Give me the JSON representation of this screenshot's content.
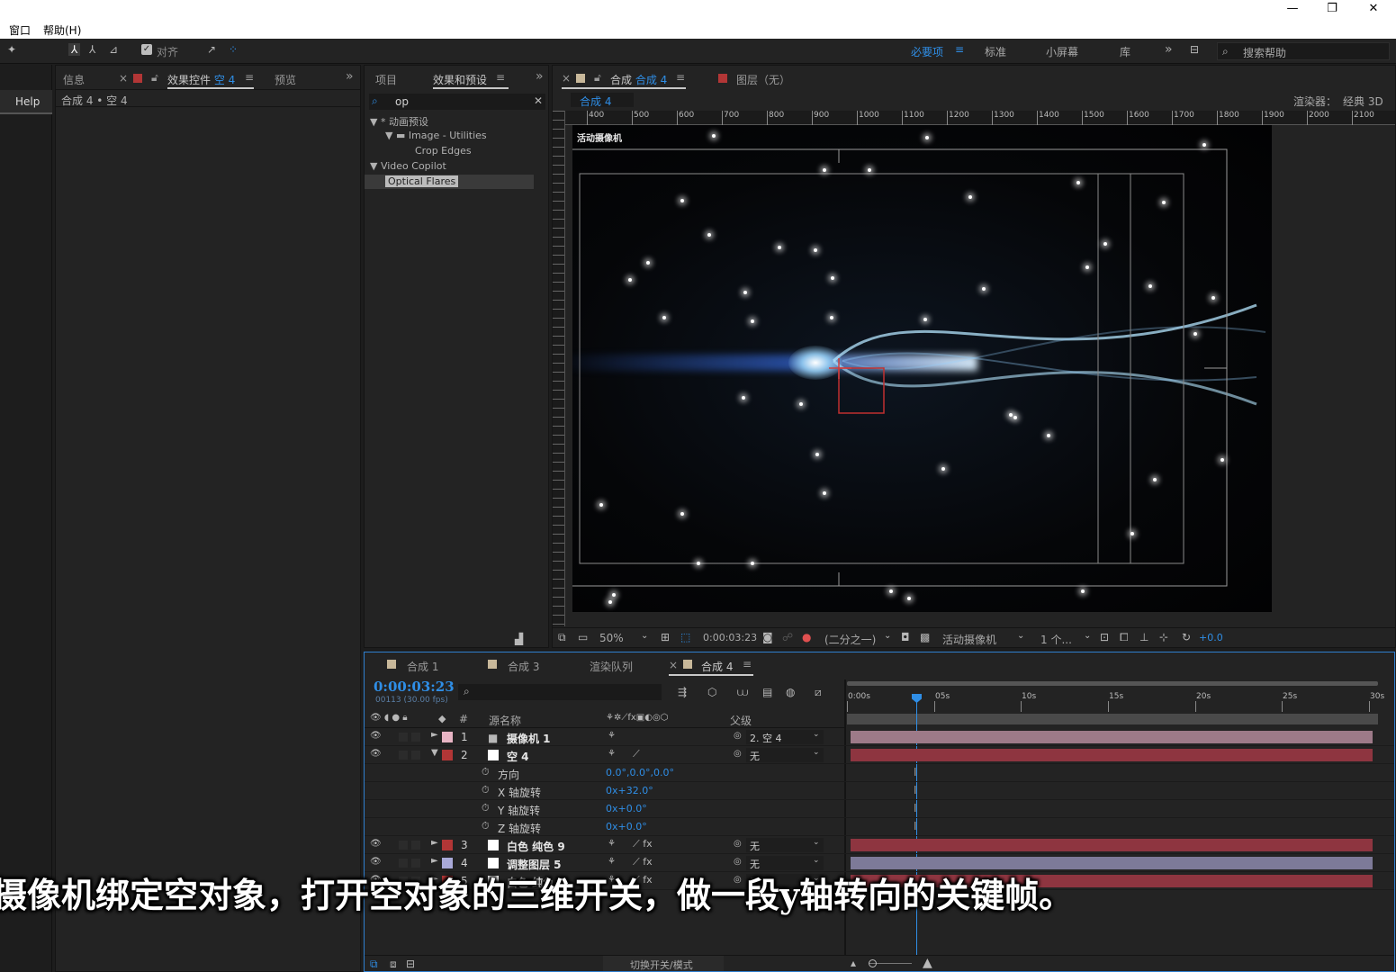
{
  "menu": {
    "window": "窗口",
    "help": "帮助(H)"
  },
  "toolbar": {
    "align_label": "对齐",
    "workspaces": [
      "必要项",
      "标准",
      "小屏幕",
      "库"
    ],
    "search_placeholder": "搜索帮助",
    "menu_glyph": "≡",
    "overflow": "»"
  },
  "left_rail": {
    "help_label": "Help"
  },
  "effects_controls": {
    "tabs": [
      "信息",
      "效果控件 空 4",
      "预览"
    ],
    "tab_prefix": "效果控件 ",
    "tab_highlight": "空 4",
    "breadcrumb": "合成 4 • 空 4"
  },
  "effects_presets": {
    "tabs": [
      "项目",
      "效果和预设"
    ],
    "search_value": "op",
    "tree": [
      {
        "label": "▼ * 动画预设",
        "indent": 0
      },
      {
        "label": "▼ ▬ Image - Utilities",
        "indent": 1
      },
      {
        "label": "Crop Edges",
        "indent": 2
      },
      {
        "label": "▼ Video Copilot",
        "indent": 0
      },
      {
        "label": "Optical Flares",
        "indent": 1,
        "selected": true
      }
    ]
  },
  "composition": {
    "tab_prefix": "合成",
    "tab_name": "合成 4",
    "layer_tab": "图层（无）",
    "sub_tab": "合成 4",
    "renderer_label": "渲染器：",
    "renderer_value": "经典 3D",
    "ruler_ticks": [
      "400",
      "500",
      "600",
      "700",
      "800",
      "900",
      "1000",
      "1100",
      "1200",
      "1300",
      "1400",
      "1500",
      "1600",
      "1700",
      "1800",
      "1900",
      "2000",
      "2100"
    ],
    "camera_label": "活动摄像机"
  },
  "viewer_toolbar": {
    "zoom": "50%",
    "timecode": "0:00:03:23",
    "resolution": "(二分之一)",
    "camera": "活动摄像机",
    "views": "1 个...",
    "exposure": "+0.0"
  },
  "timeline": {
    "tabs": [
      "合成 1",
      "合成 3",
      "渲染队列",
      "合成 4"
    ],
    "timecode": "0:00:03:23",
    "fps": "00113 (30.00 fps)",
    "col_source": "源名称",
    "col_num": "#",
    "col_parent": "父级",
    "time_ticks": [
      "0:00s",
      "05s",
      "10s",
      "15s",
      "20s",
      "25s",
      "30s"
    ],
    "playhead_fraction": 0.1326,
    "layers": [
      {
        "num": "1",
        "name": "摄像机 1",
        "color": "#e8b4c4",
        "parent": "2. 空 4",
        "expanded": false,
        "bar": "#9d7a88"
      },
      {
        "num": "2",
        "name": "空 4",
        "color": "#b23636",
        "parent": "无",
        "expanded": true,
        "bar": "#8e3540"
      },
      {
        "num": "3",
        "name": "白色 纯色 9",
        "color": "#b23636",
        "parent": "无",
        "expanded": false,
        "bar": "#8e3540"
      },
      {
        "num": "4",
        "name": "调整图层 5",
        "color": "#a9a9d8",
        "parent": "无",
        "expanded": false,
        "bar": "#7d7a98"
      },
      {
        "num": "5",
        "name": "白色 纯色",
        "color": "#b23636",
        "parent": "无",
        "expanded": false,
        "bar": "#8e3540"
      }
    ],
    "properties": [
      {
        "name": "方向",
        "value": "0.0°,0.0°,0.0°"
      },
      {
        "name": "X 轴旋转",
        "value": "0x+32.0°"
      },
      {
        "name": "Y 轴旋转",
        "value": "0x+0.0°"
      },
      {
        "name": "Z 轴旋转",
        "value": "0x+0.0°"
      }
    ],
    "bottom_toggle": "切换开关/模式"
  },
  "subtitle": "摄像机绑定空对象，打开空对象的三维开关，做一段y轴转向的关键帧。"
}
